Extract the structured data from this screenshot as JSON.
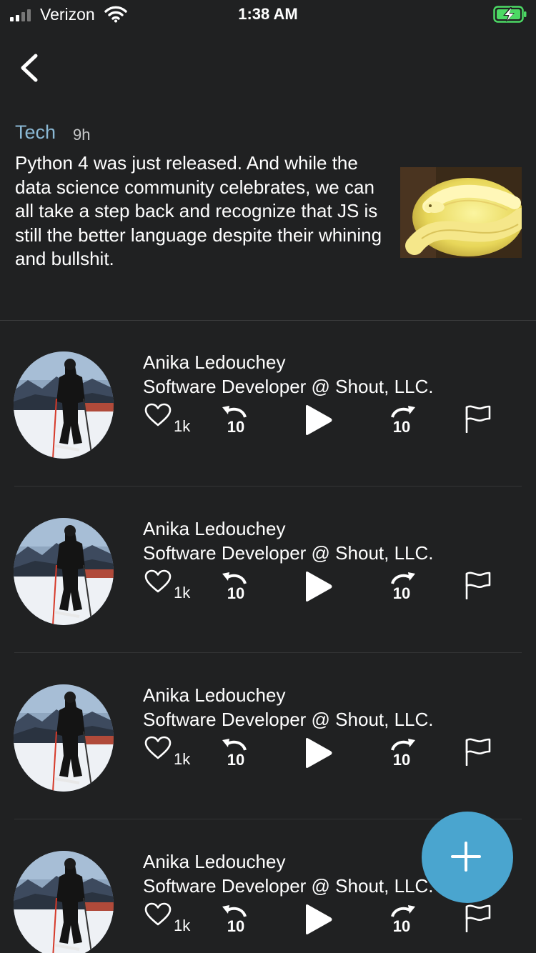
{
  "status_bar": {
    "carrier": "Verizon",
    "time": "1:38 AM",
    "signal_icon": "signal-bars-icon",
    "wifi_icon": "wifi-icon",
    "battery_icon": "battery-charging-icon"
  },
  "header": {
    "back_icon": "chevron-left-icon"
  },
  "post": {
    "category": "Tech",
    "age": "9h",
    "body": "Python 4 was just released. And while the data science community celebrates, we can all take a step back and recognize that JS is still the better language despite their whining and bullshit.",
    "image_icon": "python-snake-photo"
  },
  "replies": [
    {
      "name": "Anika Ledouchey",
      "title": "Software Developer @ Shout, LLC.",
      "likes": "1k",
      "rewind_label": "10",
      "forward_label": "10"
    },
    {
      "name": "Anika Ledouchey",
      "title": "Software Developer @ Shout, LLC.",
      "likes": "1k",
      "rewind_label": "10",
      "forward_label": "10"
    },
    {
      "name": "Anika Ledouchey",
      "title": "Software Developer @ Shout, LLC.",
      "likes": "1k",
      "rewind_label": "10",
      "forward_label": "10"
    },
    {
      "name": "Anika Ledouchey",
      "title": "Software Developer @ Shout, LLC.",
      "likes": "1k",
      "rewind_label": "10",
      "forward_label": "10"
    }
  ],
  "fab": {
    "icon": "plus-icon"
  },
  "colors": {
    "background": "#202122",
    "accent": "#4aa5cf",
    "category": "#8ab8d4",
    "battery": "#4cd964"
  }
}
